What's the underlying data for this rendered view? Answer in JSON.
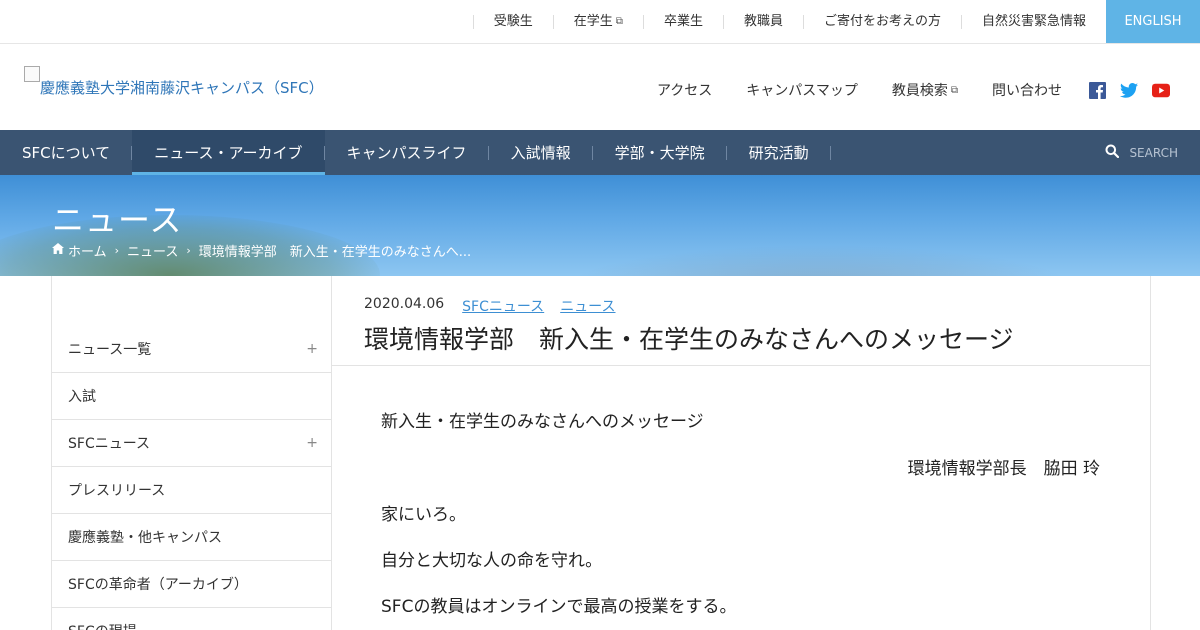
{
  "topbar": {
    "links": [
      {
        "label": "受験生",
        "external": false
      },
      {
        "label": "在学生",
        "external": true
      },
      {
        "label": "卒業生",
        "external": false
      },
      {
        "label": "教職員",
        "external": false
      },
      {
        "label": "ご寄付をお考えの方",
        "external": false
      },
      {
        "label": "自然災害緊急情報",
        "external": false
      }
    ],
    "english_label": "ENGLISH"
  },
  "header": {
    "site_title": "慶應義塾大学湘南藤沢キャンパス（SFC）",
    "nav": [
      {
        "label": "アクセス",
        "external": false
      },
      {
        "label": "キャンパスマップ",
        "external": false
      },
      {
        "label": "教員検索",
        "external": true
      },
      {
        "label": "問い合わせ",
        "external": false
      }
    ],
    "social": [
      {
        "icon": "facebook-icon",
        "color": "#3b5998"
      },
      {
        "icon": "twitter-icon",
        "color": "#1da1f2"
      },
      {
        "icon": "youtube-icon",
        "color": "#e62117"
      }
    ]
  },
  "mainnav": {
    "items": [
      "SFCについて",
      "ニュース・アーカイブ",
      "キャンパスライフ",
      "入試情報",
      "学部・大学院",
      "研究活動"
    ],
    "active_index": 1,
    "search_label": "SEARCH"
  },
  "hero": {
    "heading": "ニュース",
    "breadcrumb": [
      "ホーム",
      "ニュース",
      "環境情報学部　新入生・在学生のみなさんへ..."
    ]
  },
  "sidebar": {
    "items": [
      {
        "label": "ニュース一覧",
        "expandable": true
      },
      {
        "label": "入試",
        "expandable": false
      },
      {
        "label": "SFCニュース",
        "expandable": true
      },
      {
        "label": "プレスリリース",
        "expandable": false
      },
      {
        "label": "慶應義塾・他キャンパス",
        "expandable": false
      },
      {
        "label": "SFCの革命者（アーカイブ）",
        "expandable": false
      },
      {
        "label": "SFCの現場",
        "expandable": false
      }
    ]
  },
  "article": {
    "date": "2020.04.06",
    "tags": [
      "SFCニュース",
      "ニュース"
    ],
    "title": "環境情報学部　新入生・在学生のみなさんへのメッセージ",
    "paragraphs": [
      "新入生・在学生のみなさんへのメッセージ",
      "環境情報学部長　脇田 玲",
      "家にいろ。",
      "自分と大切な人の命を守れ。",
      "SFCの教員はオンラインで最高の授業をする。"
    ]
  },
  "colors": {
    "accent": "#5fb4e6",
    "nav_bg": "#3a5472",
    "link": "#3d8fd3"
  }
}
